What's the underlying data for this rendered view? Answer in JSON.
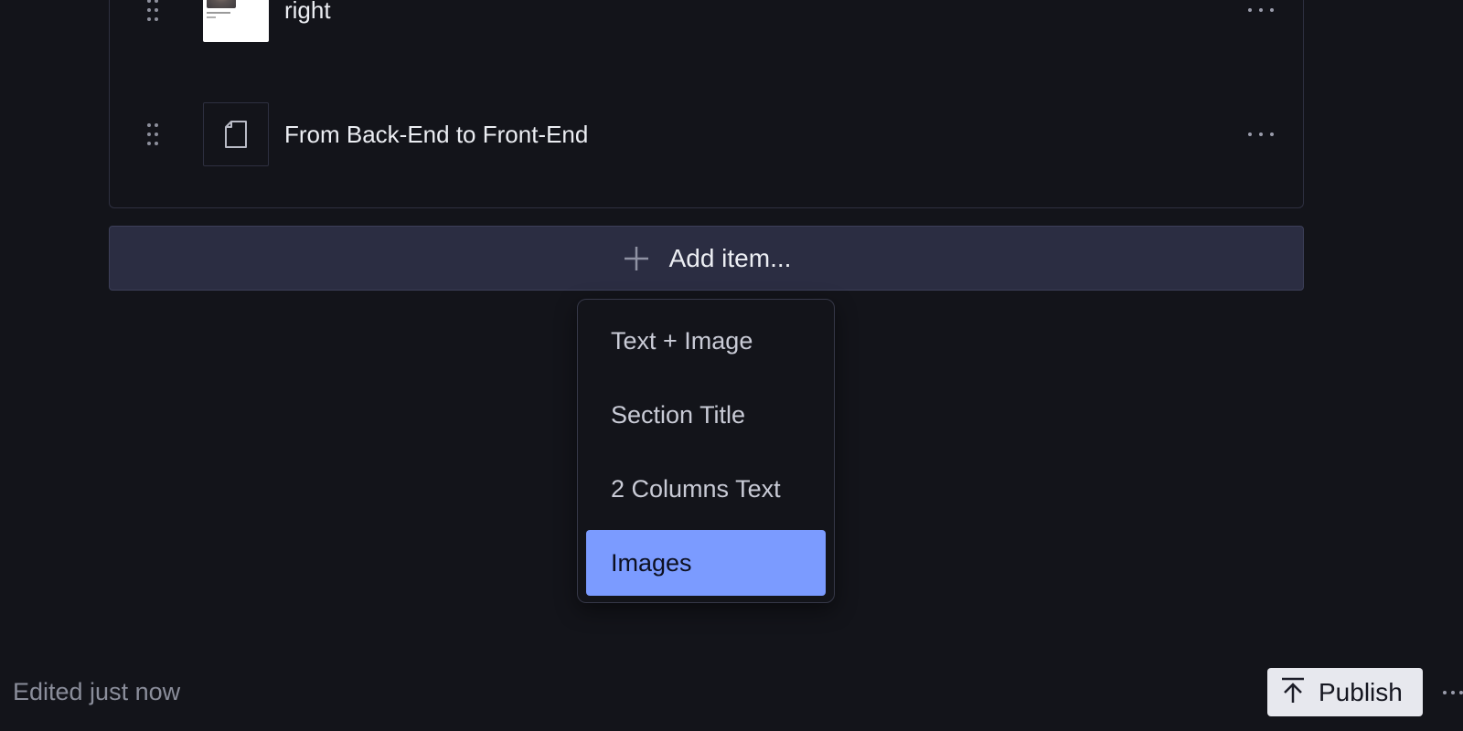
{
  "list": {
    "items": [
      {
        "title": "right",
        "thumbnail": "photo-thumbnail"
      },
      {
        "title": "From Back-End to Front-End",
        "thumbnail": "document-icon"
      }
    ]
  },
  "add_item": {
    "label": "Add item..."
  },
  "menu": {
    "items": [
      {
        "label": "Text + Image"
      },
      {
        "label": "Section Title"
      },
      {
        "label": "2 Columns Text"
      },
      {
        "label": "Images",
        "highlighted": true
      }
    ]
  },
  "footer": {
    "status": "Edited just now",
    "publish_label": "Publish"
  },
  "colors": {
    "background": "#13141a",
    "add_item_bg": "#2b2d42",
    "menu_highlight": "#7b9bff",
    "publish_bg": "#e7e8ee"
  }
}
